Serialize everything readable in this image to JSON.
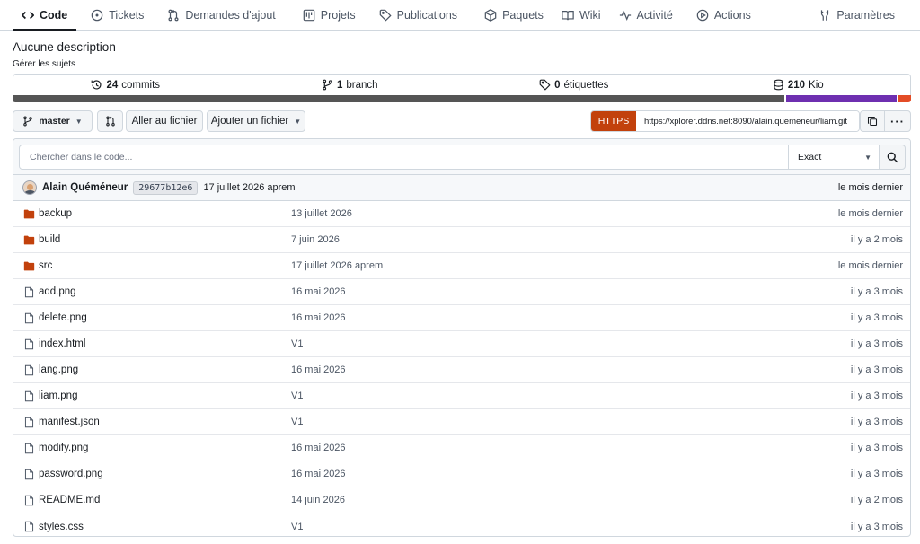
{
  "nav": {
    "tabs": [
      {
        "label": "Code",
        "icon": "code-icon"
      },
      {
        "label": "Tickets",
        "icon": "issue-icon"
      },
      {
        "label": "Demandes d'ajout",
        "icon": "pull-request-icon"
      },
      {
        "label": "Projets",
        "icon": "project-icon"
      },
      {
        "label": "Publications",
        "icon": "tag-icon"
      },
      {
        "label": "Paquets",
        "icon": "package-icon"
      },
      {
        "label": "Wiki",
        "icon": "book-icon"
      },
      {
        "label": "Activité",
        "icon": "pulse-icon"
      },
      {
        "label": "Actions",
        "icon": "play-icon"
      }
    ],
    "settings_label": "Paramètres"
  },
  "repo": {
    "description": "Aucune description",
    "manage_topics": "Gérer les sujets"
  },
  "stats": {
    "commits_count": "24",
    "commits_label": "commits",
    "branch_count": "1",
    "branch_label": "branch",
    "tags_count": "0",
    "tags_label": "étiquettes",
    "size_value": "210",
    "size_unit": "Kio"
  },
  "language_bar": [
    {
      "color": "#555555",
      "percent": 86.2
    },
    {
      "color": "#6e2fb0",
      "percent": 12.4
    },
    {
      "color": "#e34c26",
      "percent": 1.4
    }
  ],
  "toolbar": {
    "branch": "master",
    "go_to_file": "Aller au fichier",
    "add_file": "Ajouter un fichier",
    "clone_protocol": "HTTPS",
    "clone_url": "https://xplorer.ddns.net:8090/alain.quemeneur/liam.git"
  },
  "search": {
    "placeholder": "Chercher dans le code...",
    "mode": "Exact"
  },
  "last_commit": {
    "author": "Alain Quéméneur",
    "sha": "29677b12e6",
    "message": "17 juillet 2026 aprem",
    "time": "le mois dernier"
  },
  "files": [
    {
      "name": "backup",
      "type": "folder",
      "message": "13 juillet 2026",
      "time": "le mois dernier"
    },
    {
      "name": "build",
      "type": "folder",
      "message": "7 juin 2026",
      "time": "il y a 2 mois"
    },
    {
      "name": "src",
      "type": "folder",
      "message": "17 juillet 2026 aprem",
      "time": "le mois dernier"
    },
    {
      "name": "add.png",
      "type": "file",
      "message": "16 mai 2026",
      "time": "il y a 3 mois"
    },
    {
      "name": "delete.png",
      "type": "file",
      "message": "16 mai 2026",
      "time": "il y a 3 mois"
    },
    {
      "name": "index.html",
      "type": "file",
      "message": "V1",
      "time": "il y a 3 mois"
    },
    {
      "name": "lang.png",
      "type": "file",
      "message": "16 mai 2026",
      "time": "il y a 3 mois"
    },
    {
      "name": "liam.png",
      "type": "file",
      "message": "V1",
      "time": "il y a 3 mois"
    },
    {
      "name": "manifest.json",
      "type": "file",
      "message": "V1",
      "time": "il y a 3 mois"
    },
    {
      "name": "modify.png",
      "type": "file",
      "message": "16 mai 2026",
      "time": "il y a 3 mois"
    },
    {
      "name": "password.png",
      "type": "file",
      "message": "16 mai 2026",
      "time": "il y a 3 mois"
    },
    {
      "name": "README.md",
      "type": "file",
      "message": "14 juin 2026",
      "time": "il y a 2 mois"
    },
    {
      "name": "styles.css",
      "type": "file",
      "message": "V1",
      "time": "il y a 3 mois"
    }
  ],
  "colors": {
    "accent": "#c2410c",
    "folder": "#c2410c"
  }
}
